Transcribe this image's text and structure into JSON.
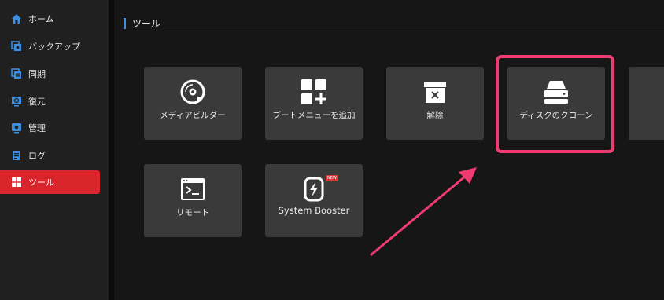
{
  "sidebar": {
    "items": [
      {
        "label": "ホーム",
        "icon": "home-icon",
        "active": false
      },
      {
        "label": "バックアップ",
        "icon": "backup-icon",
        "active": false
      },
      {
        "label": "同期",
        "icon": "sync-icon",
        "active": false
      },
      {
        "label": "復元",
        "icon": "restore-icon",
        "active": false
      },
      {
        "label": "管理",
        "icon": "manage-icon",
        "active": false
      },
      {
        "label": "ログ",
        "icon": "log-icon",
        "active": false
      },
      {
        "label": "ツール",
        "icon": "tools-icon",
        "active": true
      }
    ]
  },
  "main": {
    "section_title": "ツール",
    "tools": [
      {
        "label": "メディアビルダー",
        "icon": "disc-icon"
      },
      {
        "label": "ブートメニューを追加",
        "icon": "boot-menu-add-icon"
      },
      {
        "label": "解除",
        "icon": "uninstall-box-icon"
      },
      {
        "label": "ディスクのクローン",
        "icon": "disk-clone-icon"
      },
      {
        "label": "リモート",
        "icon": "remote-terminal-icon"
      },
      {
        "label": "System Booster",
        "icon": "system-booster-icon",
        "badge": "NEW"
      }
    ]
  },
  "colors": {
    "accent_active": "#d9262c",
    "highlight_box": "#ee3b72",
    "section_bar": "#3b8ee0"
  }
}
